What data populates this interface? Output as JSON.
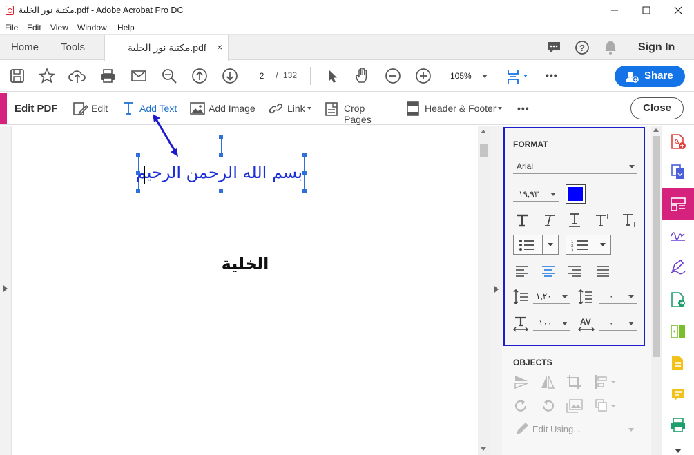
{
  "window": {
    "title": "مكتبة نور الخلية.pdf - Adobe Acrobat Pro DC",
    "minimize_icon": "minimize-icon",
    "maximize_icon": "maximize-icon",
    "close_icon": "close-icon"
  },
  "menu": [
    "File",
    "Edit",
    "View",
    "Window",
    "Help"
  ],
  "tabs": {
    "home": "Home",
    "tools": "Tools",
    "document": "مكتبة نور الخلية.pdf",
    "close_glyph": "×",
    "sign_in": "Sign In"
  },
  "toolbar": {
    "page_current": "2",
    "page_separator": "/",
    "page_total": "132",
    "zoom": "105%",
    "more": "•••",
    "share": "Share"
  },
  "editbar": {
    "title": "Edit PDF",
    "edit": "Edit",
    "add_text": "Add Text",
    "add_image": "Add Image",
    "link": "Link",
    "crop_pages": "Crop Pages",
    "header_footer": "Header & Footer",
    "more": "•••",
    "close": "Close"
  },
  "document": {
    "text_line_1": "بسم الله الرحمن الرحيم",
    "text_line_2": "الخلية"
  },
  "format_panel": {
    "title": "FORMAT",
    "font": "Arial",
    "font_size": "١٩,٩٣",
    "text_color": "#0000ff",
    "line_spacing": "١,٢٠",
    "paragraph_spacing": "٠",
    "horizontal_scaling": "١٠٠",
    "char_spacing": "٠"
  },
  "objects_panel": {
    "title": "OBJECTS",
    "edit_using": "Edit Using..."
  },
  "colors": {
    "accent_blue": "#1473e6",
    "edit_pink": "#d5237d",
    "highlight_box": "#1c1ccc",
    "add_text_blue": "#1a6fd0"
  }
}
